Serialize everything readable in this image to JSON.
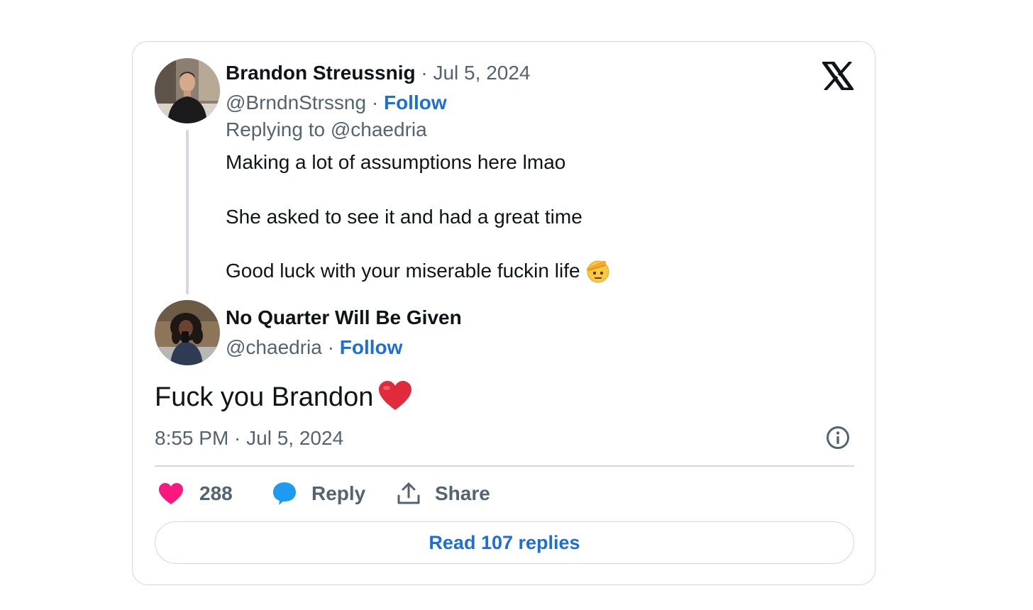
{
  "reply_tweet": {
    "author_name": "Brandon Streussnig",
    "date": "Jul 5, 2024",
    "handle": "@BrndnStrssng",
    "follow_label": "Follow",
    "replying_to": "Replying to @chaedria",
    "lines": [
      "Making a lot of assumptions here lmao",
      "She asked to see it and had a great time",
      "Good luck with your miserable fuckin life"
    ],
    "trailing_emoji": "saluting-face-emoji"
  },
  "main_tweet": {
    "author_name": "No Quarter Will Be Given",
    "handle": "@chaedria",
    "follow_label": "Follow",
    "text": "Fuck you Brandon",
    "trailing_emoji": "red-heart-emoji",
    "timestamp": "8:55 PM · Jul 5, 2024"
  },
  "actions": {
    "like_count": "288",
    "reply_label": "Reply",
    "share_label": "Share"
  },
  "read_replies_label": "Read 107 replies",
  "separator": "·",
  "colors": {
    "link_blue": "#1d6ed8",
    "muted_gray": "#536471",
    "like_pink": "#f91880",
    "reply_blue": "#1d9bf0",
    "border": "#cfd9de"
  }
}
